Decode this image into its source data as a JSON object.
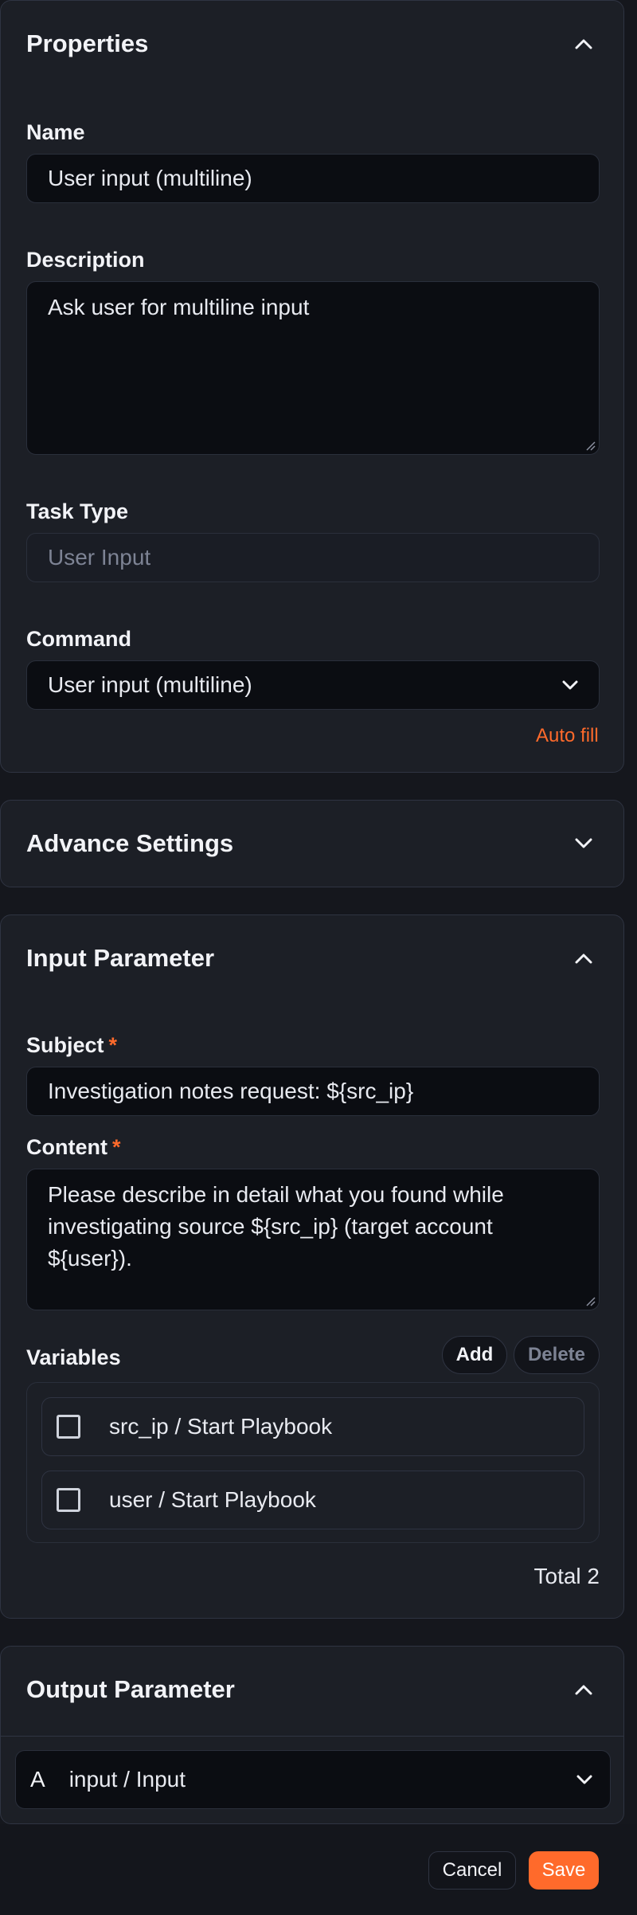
{
  "properties": {
    "title": "Properties",
    "name_label": "Name",
    "name_value": "User input (multiline)",
    "description_label": "Description",
    "description_value": "Ask user for multiline input",
    "task_type_label": "Task Type",
    "task_type_value": "User Input",
    "command_label": "Command",
    "command_value": "User input (multiline)",
    "auto_fill": "Auto fill"
  },
  "advance": {
    "title": "Advance Settings"
  },
  "input_parameter": {
    "title": "Input Parameter",
    "subject_label": "Subject",
    "subject_value": "Investigation notes request: ${src_ip}",
    "content_label": "Content",
    "content_value": "Please describe in detail what you found while\ninvestigating source ${src_ip} (target account\n${user}).",
    "required_mark": "*",
    "variables_label": "Variables",
    "add_label": "Add",
    "delete_label": "Delete",
    "variables": [
      {
        "label": "src_ip / Start Playbook",
        "checked": false
      },
      {
        "label": "user / Start Playbook",
        "checked": false
      }
    ],
    "total": "Total 2"
  },
  "output_parameter": {
    "title": "Output Parameter",
    "type_badge": "A",
    "item": "input / Input"
  },
  "footer": {
    "cancel": "Cancel",
    "save": "Save"
  },
  "colors": {
    "accent": "#ff6a2b",
    "background": "#15171d",
    "card": "#1c1f26",
    "field": "#0b0d12"
  },
  "icons": {
    "collapse": "chevron-up-icon",
    "expand": "chevron-down-icon",
    "checkbox": "checkbox-icon"
  }
}
